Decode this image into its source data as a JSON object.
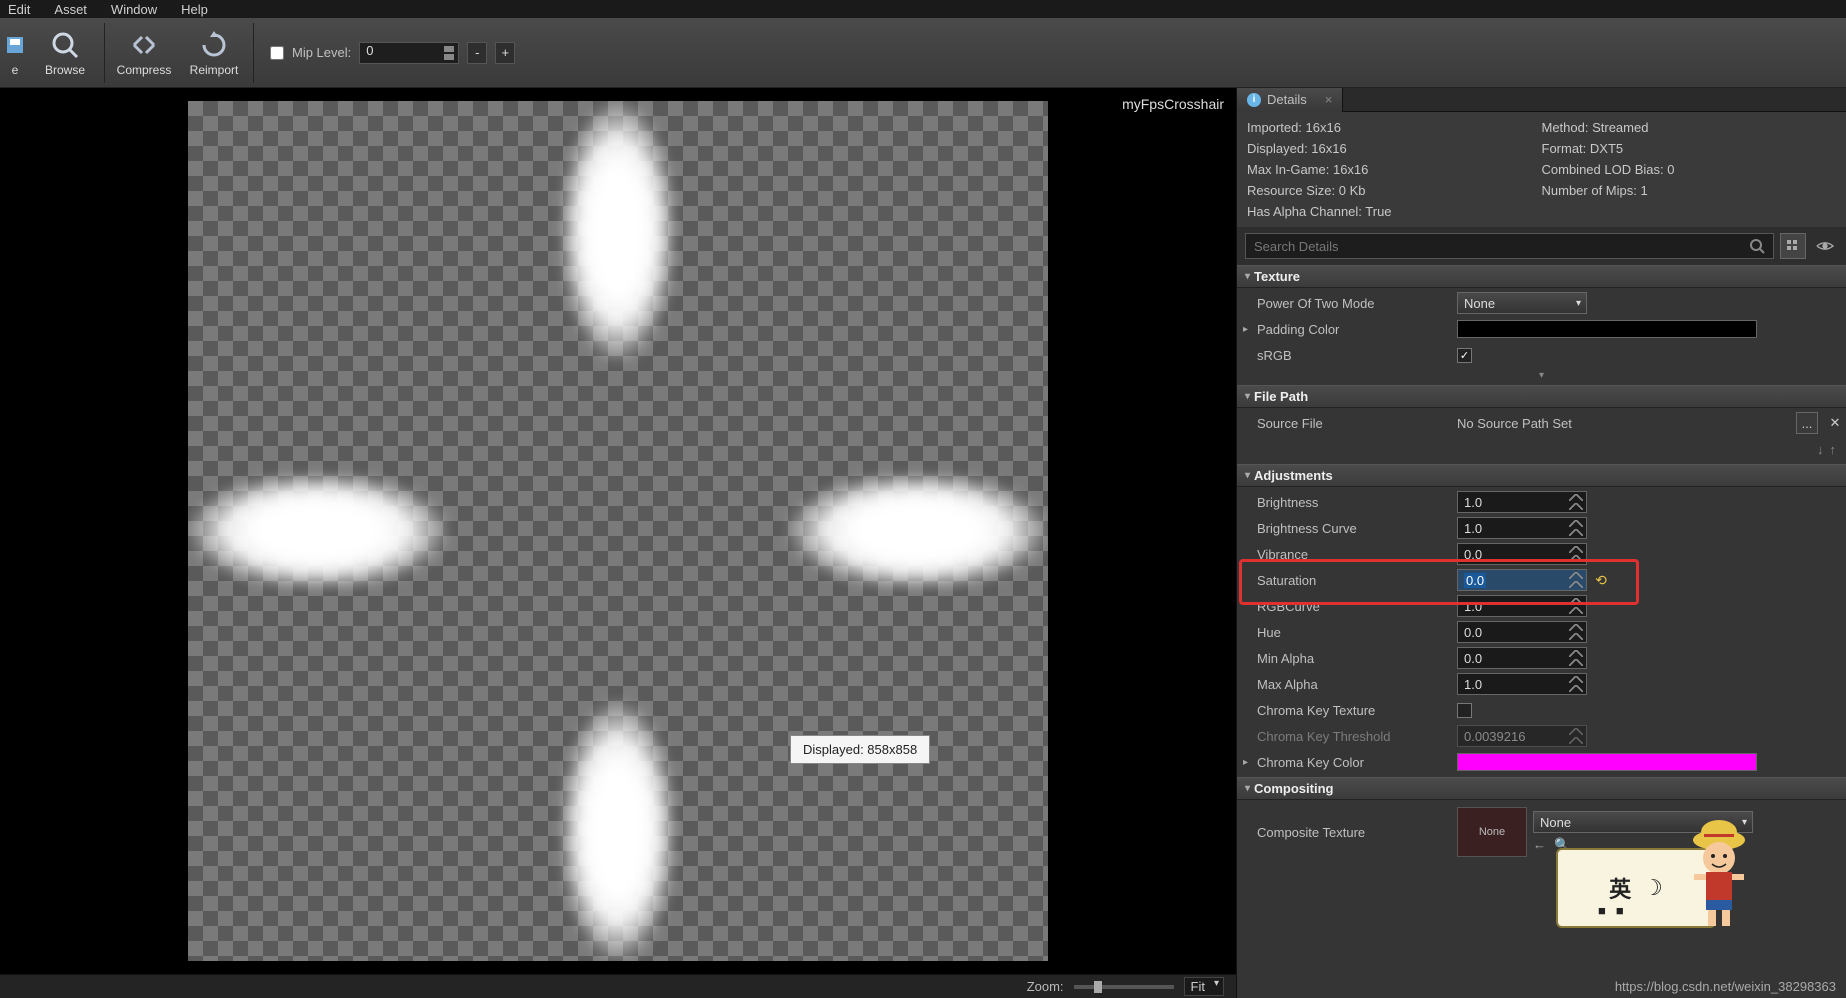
{
  "menu": {
    "edit": "Edit",
    "asset": "Asset",
    "window": "Window",
    "help": "Help"
  },
  "toolbar": {
    "e": "e",
    "browse": "Browse",
    "compress": "Compress",
    "reimport": "Reimport",
    "mip_label": "Mip Level:",
    "mip_value": "0",
    "minus": "-",
    "plus": "+"
  },
  "viewport": {
    "asset_name": "myFpsCrosshair",
    "tooltip": "Displayed: 858x858",
    "zoom_label": "Zoom:",
    "fit": "Fit",
    "corner": "▾"
  },
  "details": {
    "tab": "Details",
    "tab_close": "×",
    "info": {
      "imported": "Imported: 16x16",
      "method": "Method: Streamed",
      "displayed": "Displayed: 16x16",
      "format": "Format: DXT5",
      "maxingame": "Max In-Game: 16x16",
      "lod": "Combined LOD Bias: 0",
      "resource": "Resource Size: 0 Kb",
      "mips": "Number of Mips: 1",
      "alpha": "Has Alpha Channel: True"
    },
    "search_placeholder": "Search Details",
    "cats": {
      "texture": "Texture",
      "filepath": "File Path",
      "adjustments": "Adjustments",
      "compositing": "Compositing"
    },
    "texture": {
      "pot": "Power Of Two Mode",
      "pot_val": "None",
      "padding": "Padding Color",
      "srgb": "sRGB"
    },
    "filepath": {
      "source": "Source File",
      "source_val": "No Source Path Set",
      "dots": "...",
      "x": "✕"
    },
    "adj": {
      "brightness": "Brightness",
      "brightness_v": "1.0",
      "curve": "Brightness Curve",
      "curve_v": "1.0",
      "vib": "Vibrance",
      "vib_v": "0.0",
      "sat": "Saturation",
      "sat_v": "0.0",
      "rgb": "RGBCurve",
      "rgb_v": "1.0",
      "hue": "Hue",
      "hue_v": "0.0",
      "mina": "Min Alpha",
      "mina_v": "0.0",
      "maxa": "Max Alpha",
      "maxa_v": "1.0",
      "ckt": "Chroma Key Texture",
      "ckth": "Chroma Key Threshold",
      "ckth_v": "0.0039216",
      "ckc": "Chroma Key Color"
    },
    "comp": {
      "tex": "Composite Texture",
      "none": "None",
      "dd_none": "None"
    }
  },
  "luffy": {
    "a": "英",
    "b": "☽",
    "c": "■",
    "d": "■"
  },
  "watermark": "https://blog.csdn.net/weixin_38298363"
}
